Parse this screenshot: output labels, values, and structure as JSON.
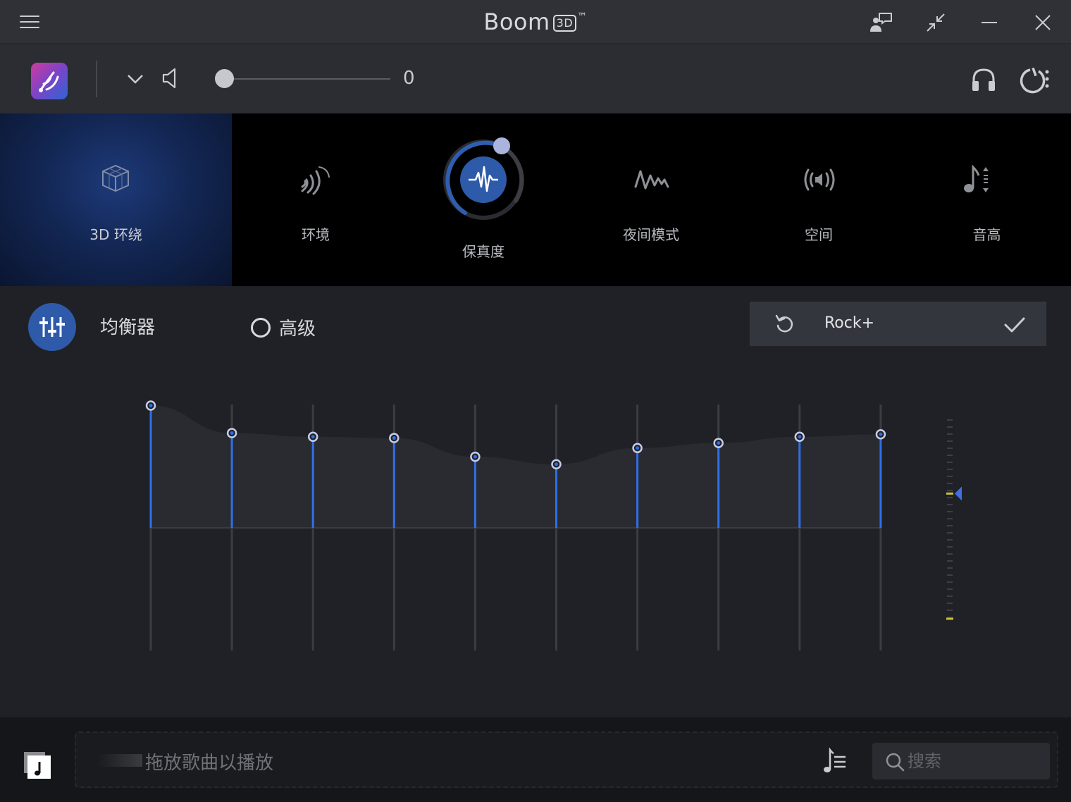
{
  "window": {
    "title_main": "Boom",
    "title_badge": "3D",
    "title_tm": "™",
    "icons": [
      "hamburger-menu-icon",
      "feedback-icon",
      "compact-mode-icon",
      "minimize-icon",
      "close-icon"
    ]
  },
  "toolbar": {
    "volume_value": "0",
    "volume_level": 0,
    "icons": [
      "app-logo",
      "chevron-down-icon",
      "speaker-icon",
      "headphones-icon",
      "power-menu-icon"
    ]
  },
  "effects": [
    {
      "label": "3D 环绕",
      "icon": "cube-icon",
      "selected": true
    },
    {
      "label": "环境",
      "icon": "ambience-icon"
    },
    {
      "label": "保真度",
      "icon": "fidelity-icon",
      "dial": true
    },
    {
      "label": "夜间模式",
      "icon": "night-mode-wave-icon"
    },
    {
      "label": "空间",
      "icon": "spatial-icon"
    },
    {
      "label": "音高",
      "icon": "pitch-icon"
    }
  ],
  "equalizer": {
    "title": "均衡器",
    "advanced_label": "高级",
    "advanced_checked": false,
    "preset": "Rock+",
    "band_levels": [
      0.98,
      0.76,
      0.73,
      0.72,
      0.57,
      0.51,
      0.64,
      0.68,
      0.73,
      0.75
    ],
    "accent_color": "#2f6fe6",
    "gain_marker_level": 0.63
  },
  "bottom": {
    "drop_text": "拖放歌曲以播放",
    "search_placeholder": "搜索",
    "icons": [
      "music-file-icon",
      "playlist-icon",
      "search-icon"
    ]
  }
}
